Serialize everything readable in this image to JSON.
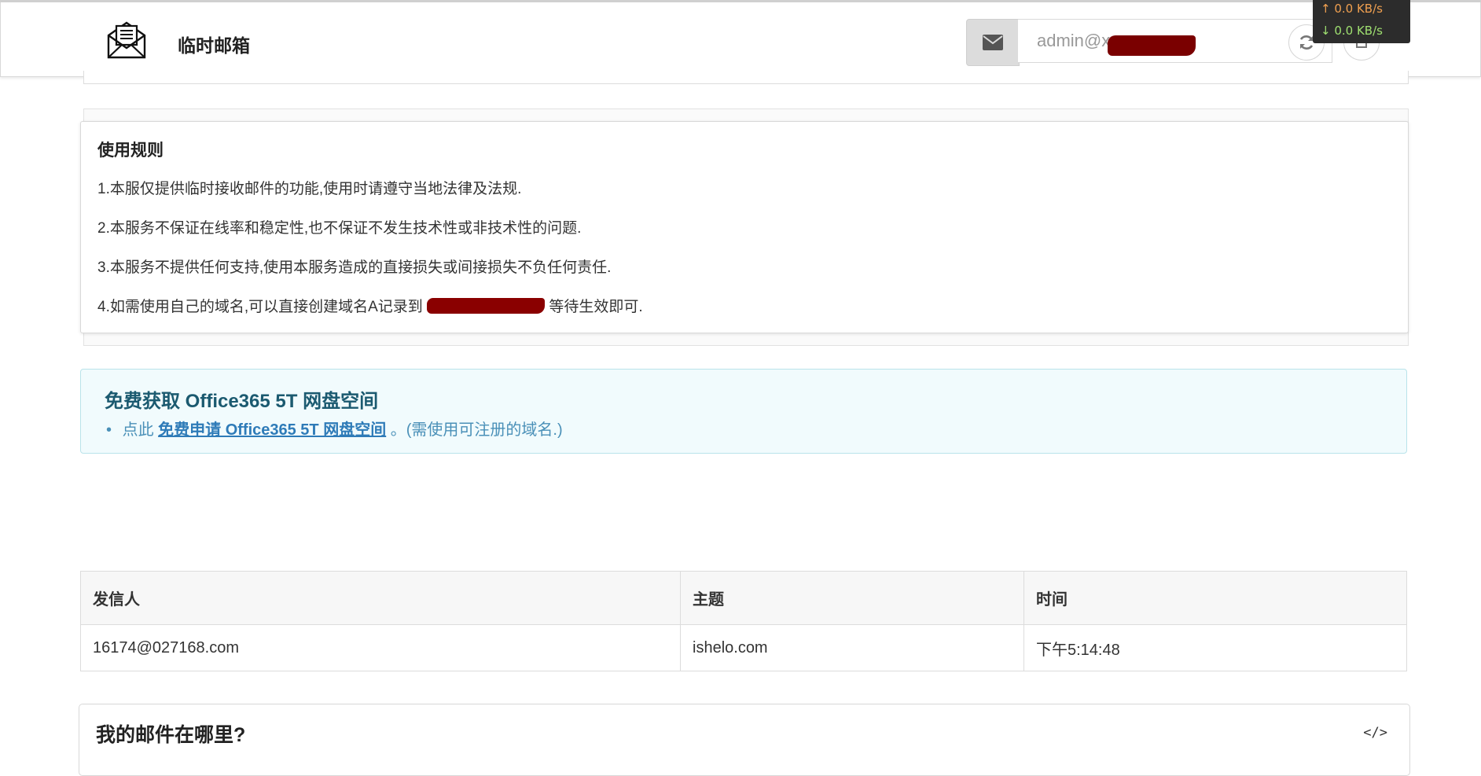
{
  "header": {
    "app_title": "临时邮箱",
    "email_value": "admin@x",
    "speed_up": "↑ 0.0 KB/s",
    "speed_down": "↓ 0.0 KB/s"
  },
  "rules": {
    "title": "使用规则",
    "items": [
      "1.本服仅提供临时接收邮件的功能,使用时请遵守当地法律及法规.",
      "2.本服务不保证在线率和稳定性,也不保证不发生技术性或非技术性的问题.",
      "3.本服务不提供任何支持,使用本服务造成的直接损失或间接损失不负任何责任."
    ],
    "item4_prefix": "4.如需使用自己的域名,可以直接创建域名A记录到",
    "item4_suffix": "等待生效即可."
  },
  "promo": {
    "title": "免费获取 Office365 5T 网盘空间",
    "item_prefix": "点此",
    "link_text": "免费申请 Office365 5T 网盘空间",
    "item_suffix": "。(需使用可注册的域名.)"
  },
  "mail_table": {
    "headers": [
      "发信人",
      "主题",
      "时间"
    ],
    "rows": [
      [
        "16174@027168.com",
        "ishelo.com",
        "下午5:14:48"
      ]
    ]
  },
  "faq": {
    "title": "我的邮件在哪里?",
    "toggle_icon": "code-icon"
  },
  "colors": {
    "accent": "#1b5a70",
    "link": "#2e7bb8",
    "redaction": "#7a0000"
  }
}
